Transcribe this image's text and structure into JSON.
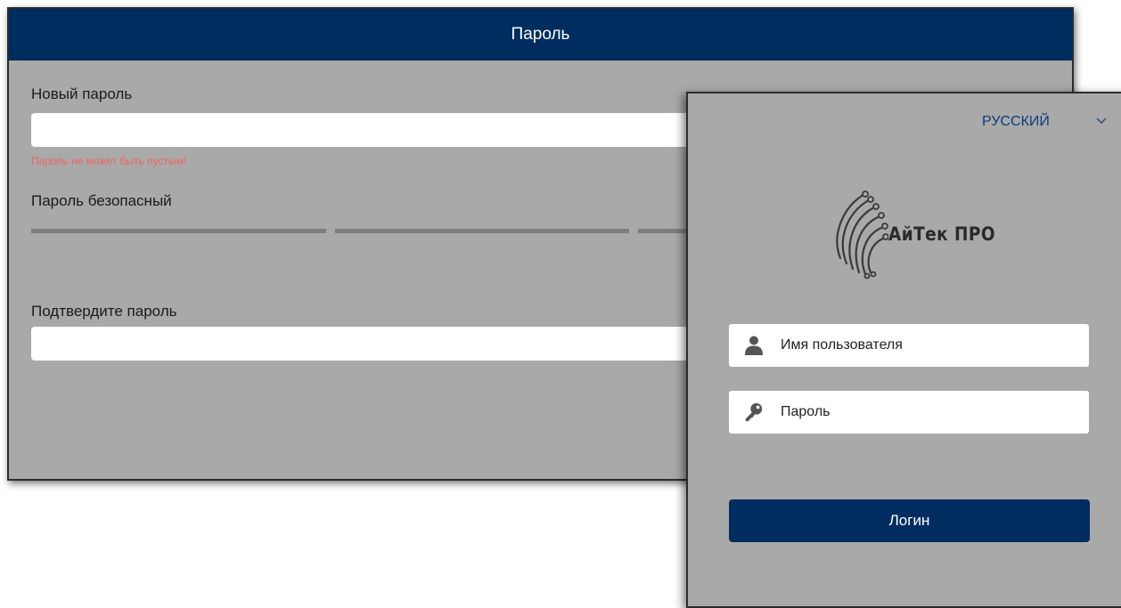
{
  "password_dialog": {
    "title": "Пароль",
    "new_password_label": "Новый пароль",
    "new_password_value": "",
    "error_message": "Пароль не может быть пустым!",
    "strength_label": "Пароль безопасный",
    "strength_bar_color": "#7d7d7d",
    "confirm_password_label": "Подтвердите пароль",
    "confirm_password_value": ""
  },
  "login_panel": {
    "language": "РУССКИЙ",
    "language_chevron_icon": "chevron-down-icon",
    "logo_text": "АйТек ПРО",
    "username_placeholder": "Имя пользователя",
    "username_icon": "user-icon",
    "password_placeholder": "Пароль",
    "password_icon": "key-icon",
    "login_button_label": "Логин"
  },
  "colors": {
    "header_bg": "#002d5f",
    "panel_bg": "#a9a9a9",
    "error_text": "#f06262",
    "link_blue": "#0a3d7a"
  }
}
